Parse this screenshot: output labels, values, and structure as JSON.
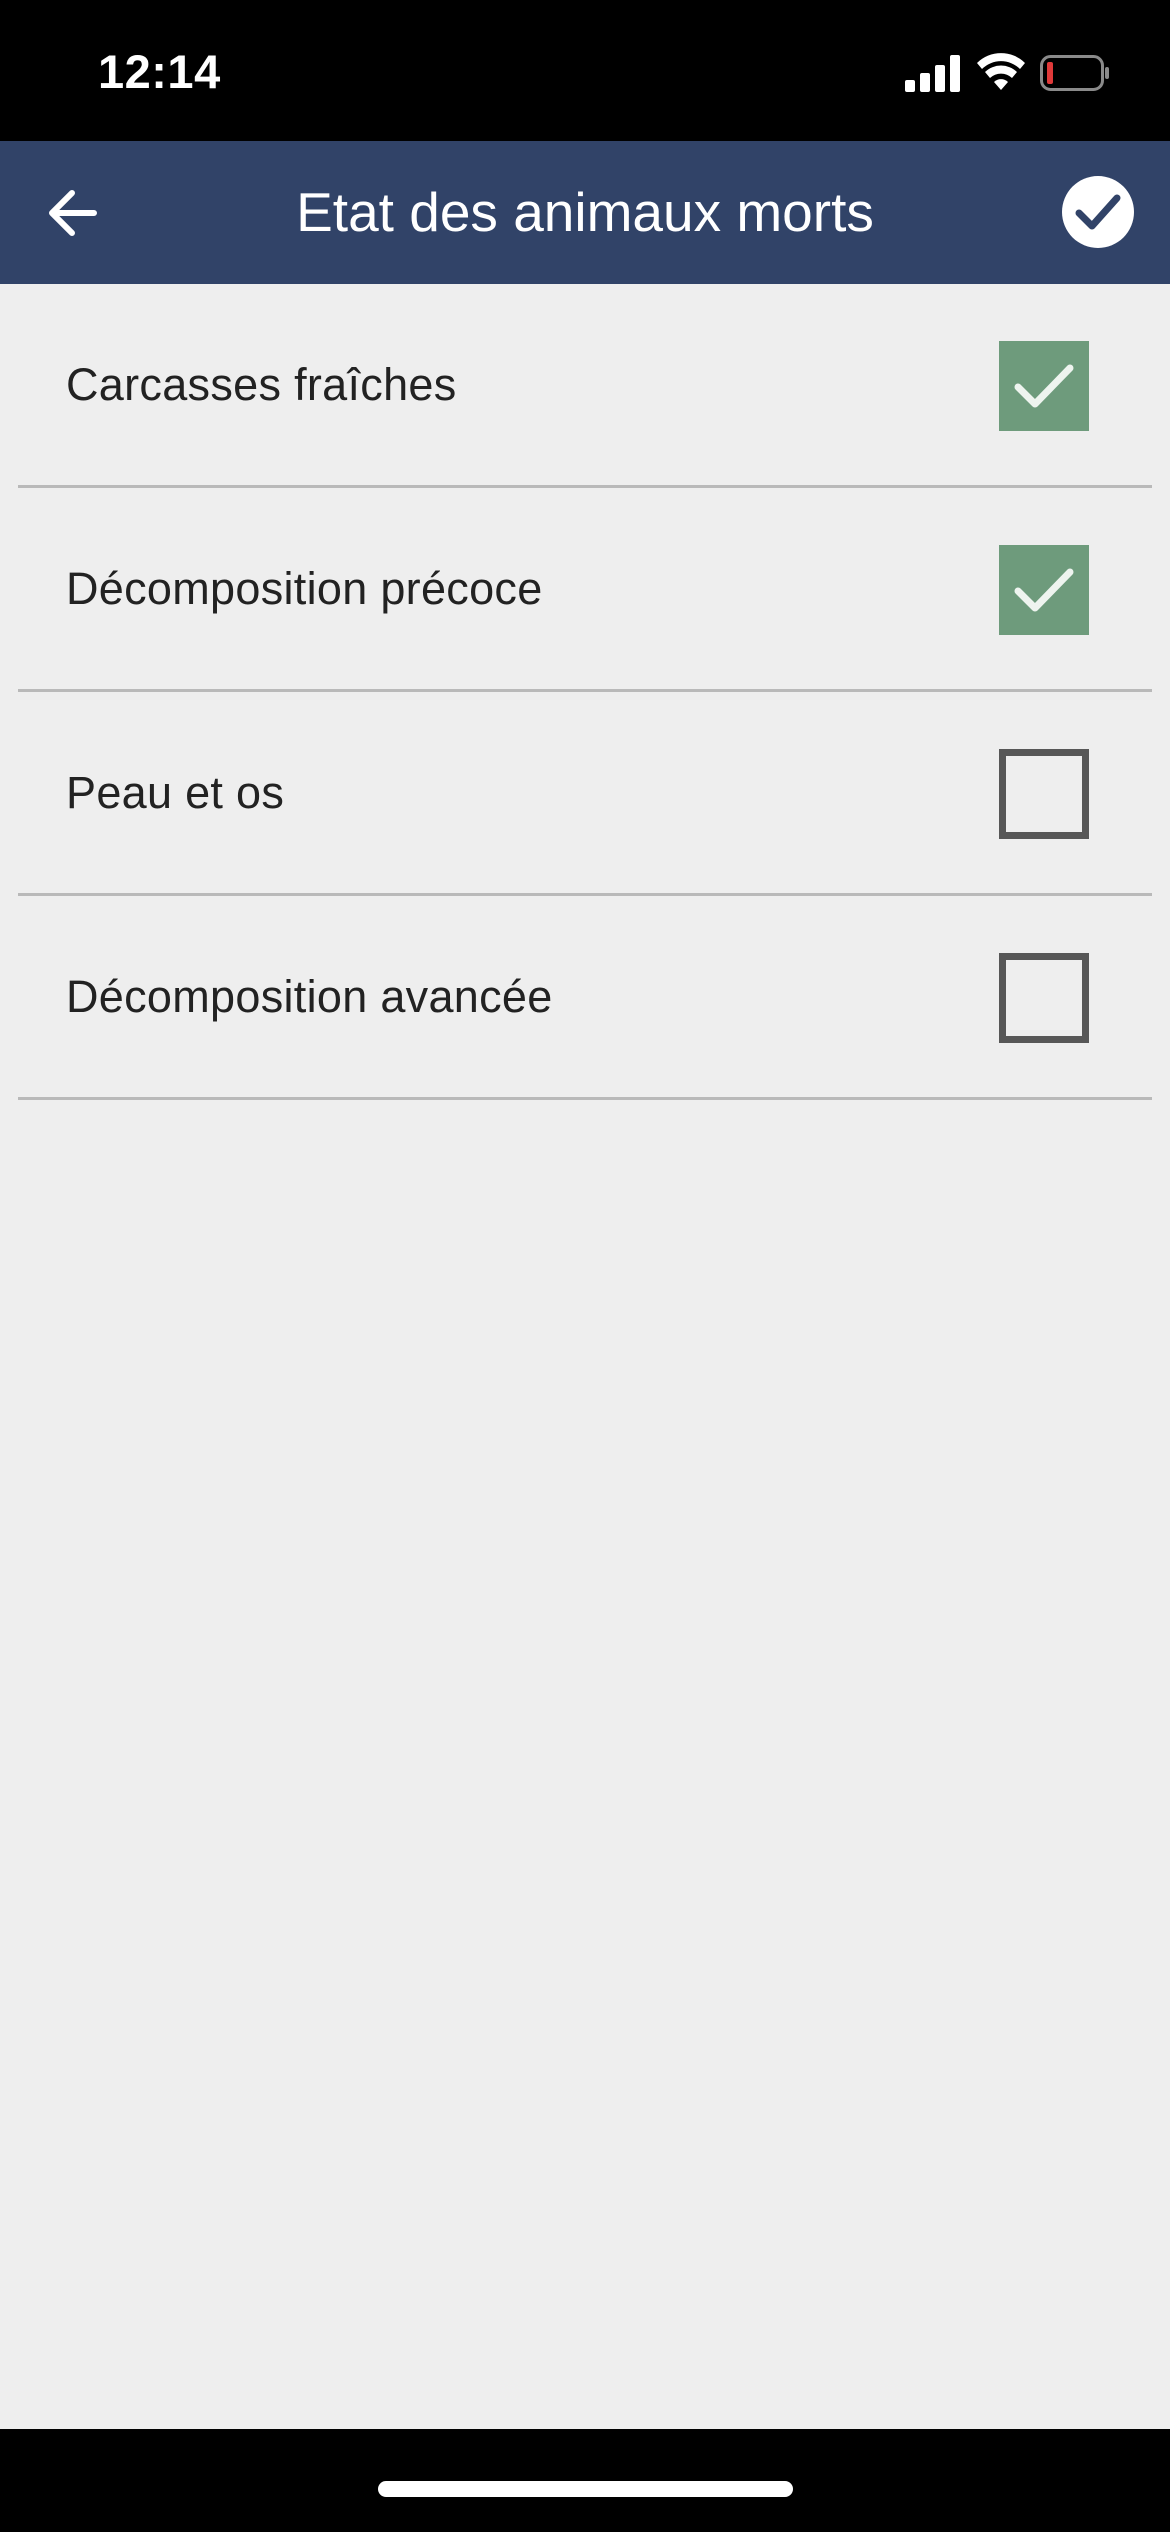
{
  "status_bar": {
    "time": "12:14",
    "icons": [
      "signal-icon",
      "wifi-icon",
      "battery-icon"
    ],
    "battery_color": "#e03a3a"
  },
  "header": {
    "title": "Etat des animaux morts",
    "back_icon": "arrow-left-icon",
    "confirm_icon": "check-circle-icon",
    "background": "#314368"
  },
  "items": [
    {
      "label": "Carcasses fraîches",
      "checked": true
    },
    {
      "label": "Décomposition précoce",
      "checked": true
    },
    {
      "label": "Peau et os",
      "checked": false
    },
    {
      "label": "Décomposition avancée",
      "checked": false
    }
  ],
  "colors": {
    "checked_fill": "#6e9b7c",
    "unchecked_border": "#575757",
    "background": "#eeeeee"
  }
}
